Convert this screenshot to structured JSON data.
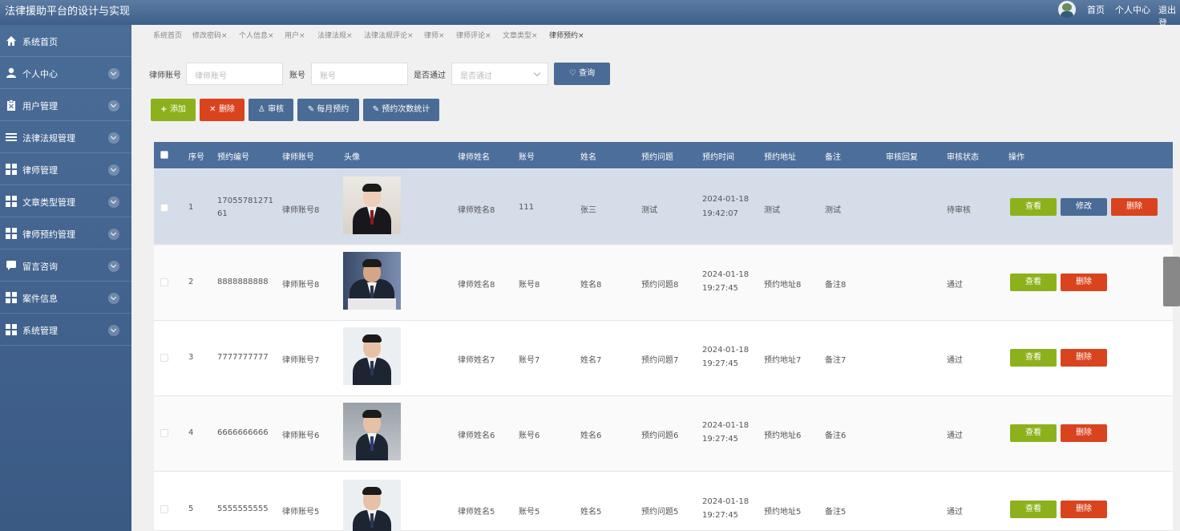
{
  "app": {
    "title": "法律援助平台的设计与实现"
  },
  "topnav": {
    "home": "首页",
    "profile": "个人中心",
    "logout": "退出登"
  },
  "sidebar": {
    "items": [
      {
        "label": "系统首页",
        "icon": "home-icon",
        "chevron": false
      },
      {
        "label": "个人中心",
        "icon": "user-icon",
        "chevron": true
      },
      {
        "label": "用户管理",
        "icon": "clipboard-icon",
        "chevron": true
      },
      {
        "label": "法律法规管理",
        "icon": "list-icon",
        "chevron": true
      },
      {
        "label": "律师管理",
        "icon": "grid-icon",
        "chevron": true
      },
      {
        "label": "文章类型管理",
        "icon": "grid-icon",
        "chevron": true
      },
      {
        "label": "律师预约管理",
        "icon": "grid-icon",
        "chevron": true
      },
      {
        "label": "留言咨询",
        "icon": "chat-icon",
        "chevron": true
      },
      {
        "label": "案件信息",
        "icon": "grid-icon",
        "chevron": true
      },
      {
        "label": "系统管理",
        "icon": "grid-icon",
        "chevron": true
      }
    ]
  },
  "tabs": [
    {
      "label": "系统首页",
      "close": ""
    },
    {
      "label": "修改密码",
      "close": "×"
    },
    {
      "label": "个人信息",
      "close": "×"
    },
    {
      "label": "用户",
      "close": "×"
    },
    {
      "label": "法律法规",
      "close": "×"
    },
    {
      "label": "法律法规评论",
      "close": "×"
    },
    {
      "label": "律师",
      "close": "×"
    },
    {
      "label": "律师评论",
      "close": "×"
    },
    {
      "label": "文章类型",
      "close": "×"
    },
    {
      "label": "律师预约",
      "close": "×"
    }
  ],
  "search": {
    "lawyer_account_label": "律师账号",
    "lawyer_account_placeholder": "律师账号",
    "account_label": "账号",
    "account_placeholder": "账号",
    "approved_label": "是否通过",
    "approved_placeholder": "是否通过",
    "query_button": "查询"
  },
  "actions": {
    "add": "添加",
    "delete": "删除",
    "review": "审核",
    "monthly": "每月预约",
    "count_stats": "预约次数统计"
  },
  "table": {
    "headers": [
      "序号",
      "预约编号",
      "律师账号",
      "头像",
      "律师姓名",
      "账号",
      "姓名",
      "预约问题",
      "预约时间",
      "预约地址",
      "备注",
      "审核回复",
      "审核状态",
      "操作"
    ],
    "rows": [
      {
        "no": "1",
        "code": "17055781271 61",
        "lawyer_account": "律师账号8",
        "lawyer_name": "律师姓名8",
        "account": "111",
        "name": "张三",
        "question": "测试",
        "date": "2024-01-18",
        "time": "19:42:07",
        "address": "测试",
        "note": "测试",
        "reply": "",
        "status": "待审核",
        "view": "查看",
        "edit": "修改",
        "delete": "删除"
      },
      {
        "no": "2",
        "code": "8888888888",
        "lawyer_account": "律师账号8",
        "lawyer_name": "律师姓名8",
        "account": "账号8",
        "name": "姓名8",
        "question": "预约问题8",
        "date": "2024-01-18",
        "time": "19:27:45",
        "address": "预约地址8",
        "note": "备注8",
        "reply": "",
        "status": "通过",
        "view": "查看",
        "delete": "删除"
      },
      {
        "no": "3",
        "code": "7777777777",
        "lawyer_account": "律师账号7",
        "lawyer_name": "律师姓名7",
        "account": "账号7",
        "name": "姓名7",
        "question": "预约问题7",
        "date": "2024-01-18",
        "time": "19:27:45",
        "address": "预约地址7",
        "note": "备注7",
        "reply": "",
        "status": "通过",
        "view": "查看",
        "delete": "删除"
      },
      {
        "no": "4",
        "code": "6666666666",
        "lawyer_account": "律师账号6",
        "lawyer_name": "律师姓名6",
        "account": "账号6",
        "name": "姓名6",
        "question": "预约问题6",
        "date": "2024-01-18",
        "time": "19:27:45",
        "address": "预约地址6",
        "note": "备注6",
        "reply": "",
        "status": "通过",
        "view": "查看",
        "delete": "删除"
      },
      {
        "no": "5",
        "code": "5555555555",
        "lawyer_account": "律师账号5",
        "lawyer_name": "律师姓名5",
        "account": "账号5",
        "name": "姓名5",
        "question": "预约问题5",
        "date": "2024-01-18",
        "time": "19:27:45",
        "address": "预约地址5",
        "note": "备注5",
        "reply": "",
        "status": "通过",
        "view": "查看",
        "delete": "删除"
      }
    ]
  },
  "colors": {
    "header_blue": "#4c6e9a",
    "green": "#8db11c",
    "red": "#d9431e",
    "blue_btn": "#4a6b95"
  }
}
